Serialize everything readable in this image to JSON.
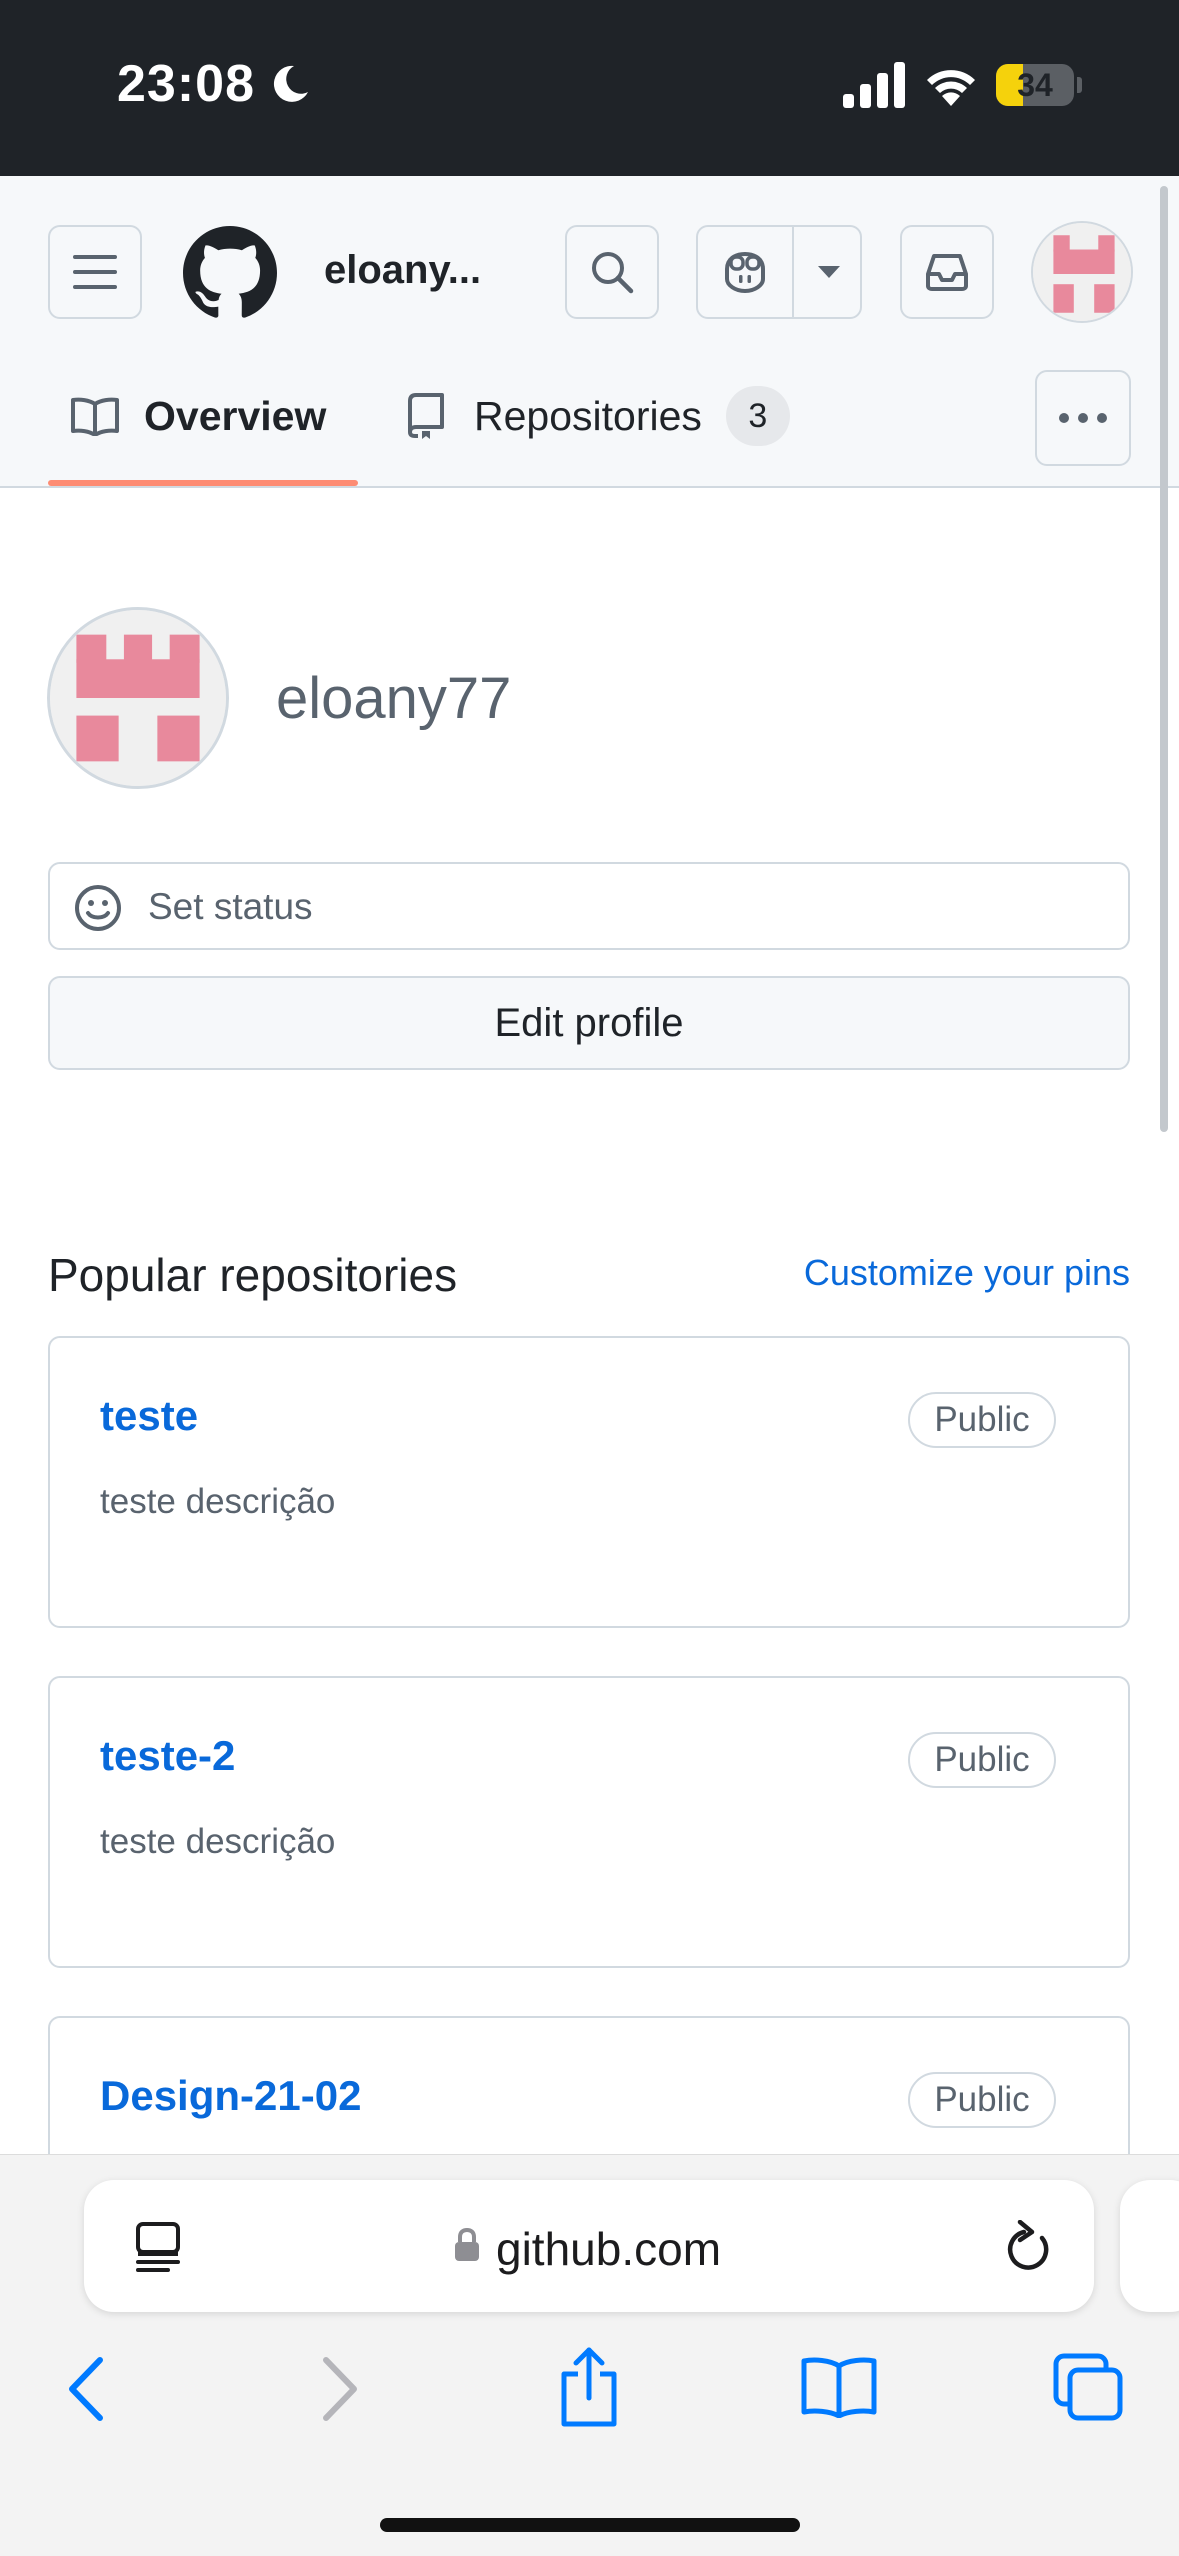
{
  "status_bar": {
    "time": "23:08",
    "battery": "34",
    "battery_level": 0.34
  },
  "header": {
    "username": "eloany...",
    "tabs": [
      {
        "label": "Overview"
      },
      {
        "label": "Repositories",
        "count": "3"
      }
    ]
  },
  "profile": {
    "username": "eloany77",
    "status_placeholder": "Set status",
    "edit_label": "Edit profile"
  },
  "popular": {
    "title": "Popular repositories",
    "customize_label": "Customize your pins",
    "repos": [
      {
        "name": "teste",
        "visibility": "Public",
        "description": "teste descrição"
      },
      {
        "name": "teste-2",
        "visibility": "Public",
        "description": "teste descrição"
      },
      {
        "name": "Design-21-02",
        "visibility": "Public",
        "description": ""
      }
    ]
  },
  "browser": {
    "url": "github.com"
  },
  "colors": {
    "link": "#0969da",
    "tab_underline": "#fd8c73",
    "safari_blue": "#007aff",
    "avatar_pink": "#e8899c"
  }
}
